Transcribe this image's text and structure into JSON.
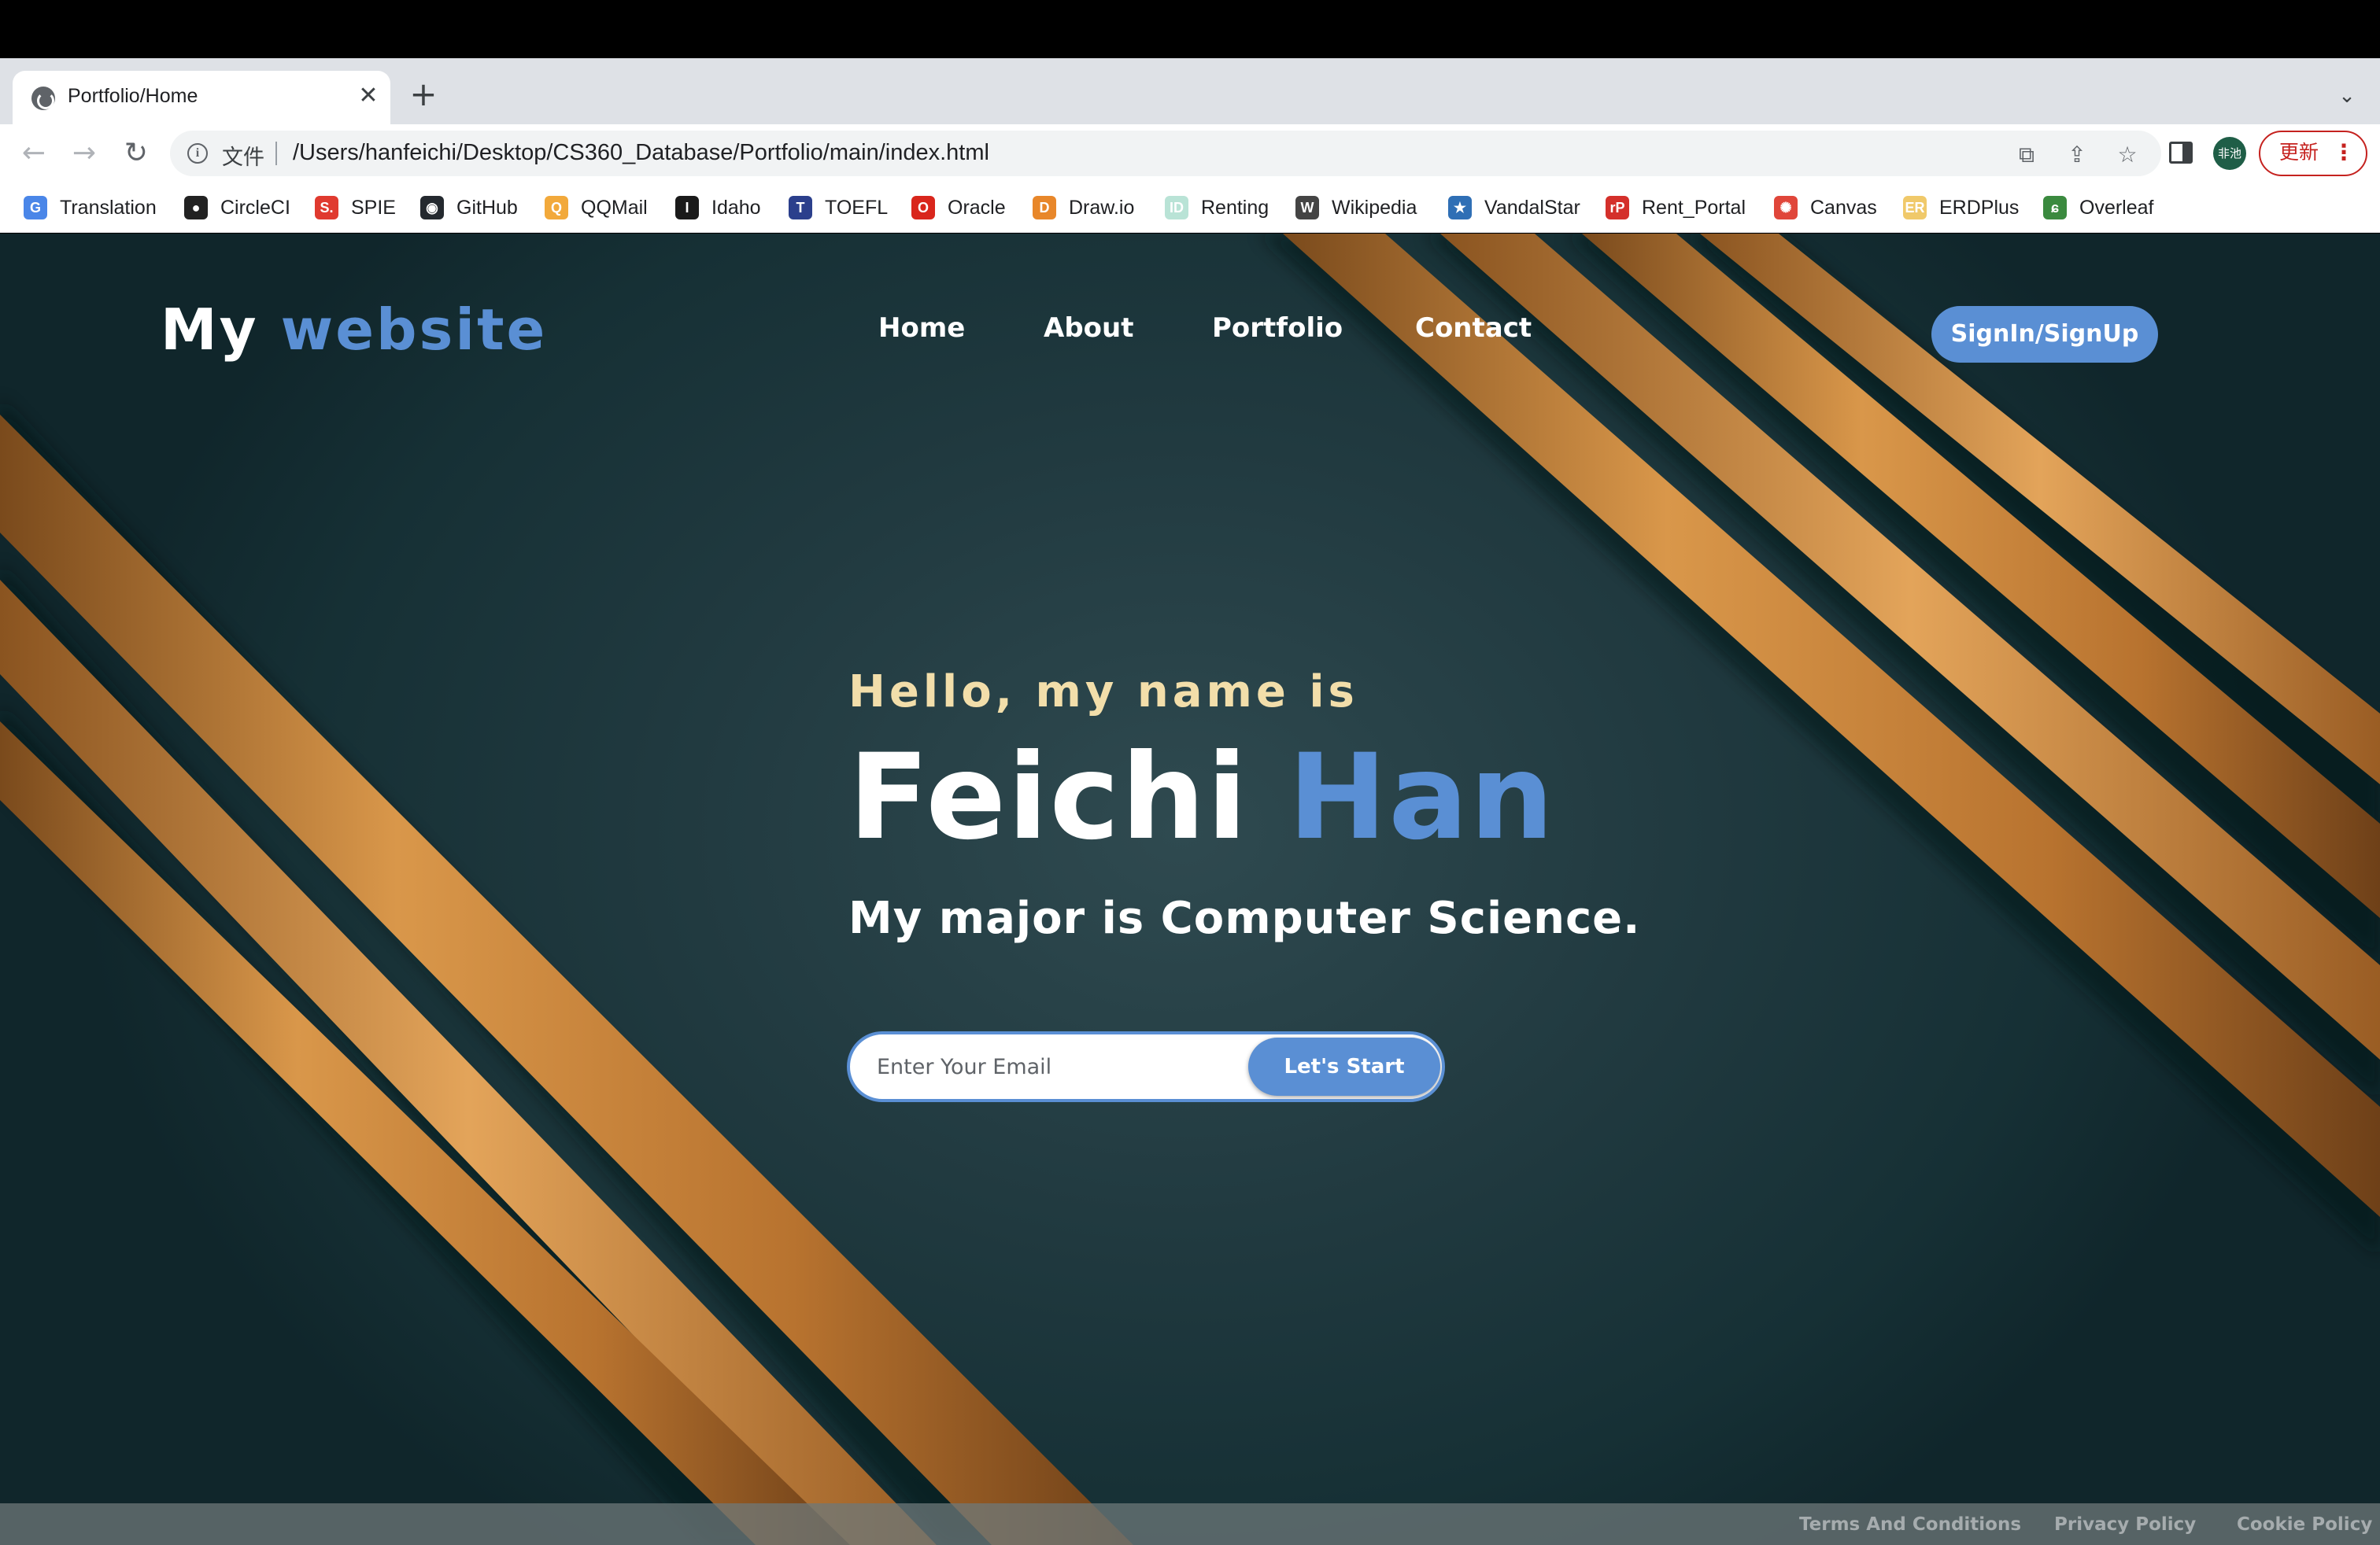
{
  "browser": {
    "tab": {
      "title": "Portfolio/Home",
      "close": "✕"
    },
    "new_tab": "+",
    "tab_menu": "⌄",
    "nav": {
      "back": "←",
      "forward": "→",
      "reload": "↻"
    },
    "omnibox": {
      "info": "i",
      "file_label": "文件",
      "url": "/Users/hanfeichi/Desktop/CS360_Database/Portfolio/main/index.html"
    },
    "actions": {
      "translate": "⧉",
      "share": "⇪",
      "bookmark": "☆"
    },
    "avatar_text": "非池",
    "update_label": "更新",
    "update_menu": "⋮",
    "bookmarks": [
      {
        "label": "Translation",
        "icon": "google-translate-icon",
        "glyph": "G",
        "color": "#4a86e8"
      },
      {
        "label": "CircleCI",
        "icon": "circleci-icon",
        "glyph": "●",
        "color": "#222222"
      },
      {
        "label": "SPIE",
        "icon": "spie-icon",
        "glyph": "S.",
        "color": "#e03a2f"
      },
      {
        "label": "GitHub",
        "icon": "github-icon",
        "glyph": "◉",
        "color": "#24292f"
      },
      {
        "label": "QQMail",
        "icon": "qqmail-icon",
        "glyph": "Q",
        "color": "#f2a93b"
      },
      {
        "label": "Idaho",
        "icon": "idaho-icon",
        "glyph": "I",
        "color": "#1a1a1a"
      },
      {
        "label": "TOEFL",
        "icon": "toefl-icon",
        "glyph": "T",
        "color": "#2b3f8c"
      },
      {
        "label": "Oracle",
        "icon": "oracle-icon",
        "glyph": "O",
        "color": "#d9261c"
      },
      {
        "label": "Draw.io",
        "icon": "drawio-icon",
        "glyph": "D",
        "color": "#e8872a"
      },
      {
        "label": "Renting",
        "icon": "renting-icon",
        "glyph": "ID",
        "color": "#b9e3d6"
      },
      {
        "label": "Wikipedia",
        "icon": "wikipedia-icon",
        "glyph": "W",
        "color": "#444444"
      },
      {
        "label": "VandalStar",
        "icon": "vandalstar-icon",
        "glyph": "★",
        "color": "#2f6fb5"
      },
      {
        "label": "Rent_Portal",
        "icon": "rentportal-icon",
        "glyph": "rP",
        "color": "#d4302b"
      },
      {
        "label": "Canvas",
        "icon": "canvas-icon",
        "glyph": "✺",
        "color": "#e0463a"
      },
      {
        "label": "ERDPlus",
        "icon": "erdplus-icon",
        "glyph": "ER",
        "color": "#f0c96a"
      },
      {
        "label": "Overleaf",
        "icon": "overleaf-icon",
        "glyph": "ɕ",
        "color": "#3b8a3f"
      }
    ]
  },
  "site": {
    "logo": {
      "first": "My",
      "accent": "website"
    },
    "nav": [
      "Home",
      "About",
      "Portfolio",
      "Contact"
    ],
    "signin_label": "SignIn/SignUp",
    "hero": {
      "greeting": "Hello, my name is",
      "first_name": "Feichi",
      "last_name": "Han",
      "major": "My major is Computer Science."
    },
    "email_placeholder": "Enter Your Email",
    "start_label": "Let's Start",
    "footer": [
      "Terms And Conditions",
      "Privacy Policy",
      "Cookie Policy"
    ]
  },
  "colors": {
    "accent": "#5a8fd4",
    "greeting": "#f2deaa",
    "background": "#1c353a",
    "stripe": "#d9974a"
  }
}
